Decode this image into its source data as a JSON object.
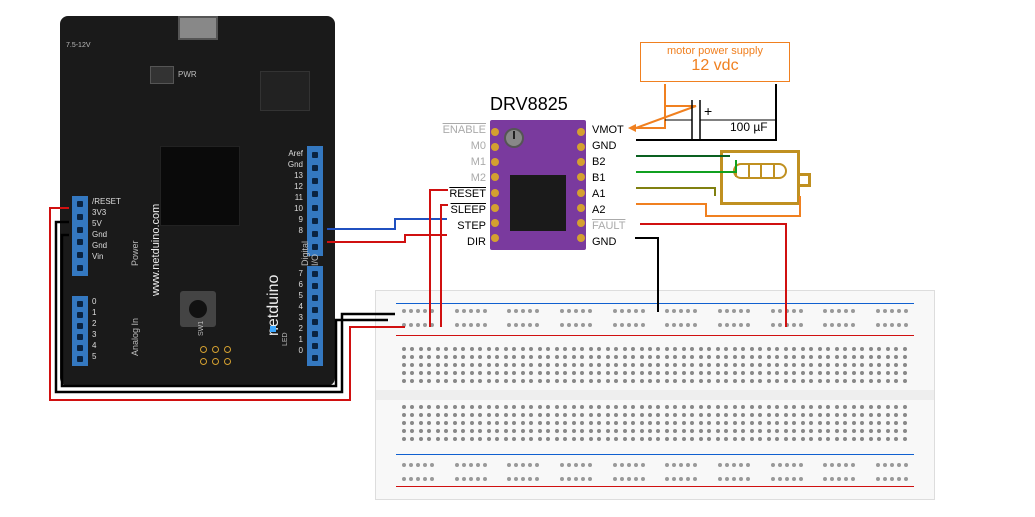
{
  "netduino": {
    "brand_url": "www.netduino.com",
    "brand_name": "netduino",
    "dc_label": "7.5-12V",
    "pwr": "PWR",
    "pin_groups": {
      "power_label": "Power",
      "power": [
        "/RESET",
        "3V3",
        "5V",
        "Gnd",
        "Gnd",
        "Vin"
      ],
      "analog_label": "Analog In",
      "analog": [
        "0",
        "1",
        "2",
        "3",
        "4",
        "5"
      ],
      "digital_label": "Digital I/O",
      "digital_top": [
        "Aref",
        "Gnd",
        "13",
        "12",
        "11",
        "10",
        "9",
        "8"
      ],
      "digital_bot": [
        "7",
        "6",
        "5",
        "4",
        "3",
        "2",
        "1",
        "0"
      ]
    },
    "sw_label": "SW1",
    "led_label": "LED"
  },
  "drv8825": {
    "title": "DRV8825",
    "left_pins": [
      "ENABLE",
      "M0",
      "M1",
      "M2",
      "RESET",
      "SLEEP",
      "STEP",
      "DIR"
    ],
    "right_pins": [
      "VMOT",
      "GND",
      "B2",
      "B1",
      "A1",
      "A2",
      "FAULT",
      "GND"
    ]
  },
  "psu": {
    "label": "motor power supply",
    "voltage": "12 vdc"
  },
  "capacitor": {
    "value": "100 µF",
    "plus": "+"
  },
  "wiring": {
    "connections": [
      {
        "from": "netduino.5V",
        "to": "breadboard.power_rail_pos",
        "color": "red"
      },
      {
        "from": "netduino.Gnd",
        "to": "breadboard.power_rail_neg",
        "color": "black"
      },
      {
        "from": "netduino.Gnd(pin)",
        "to": "breadboard.power_rail_neg",
        "color": "black"
      },
      {
        "from": "netduino.D9",
        "to": "DRV8825.STEP",
        "color": "blue"
      },
      {
        "from": "netduino.D8",
        "to": "DRV8825.DIR",
        "color": "red"
      },
      {
        "from": "breadboard.pos",
        "to": "DRV8825.RESET",
        "color": "red"
      },
      {
        "from": "breadboard.pos",
        "to": "DRV8825.SLEEP",
        "color": "red"
      },
      {
        "from": "breadboard.pos",
        "to": "DRV8825.FAULT",
        "color": "red"
      },
      {
        "from": "breadboard.neg",
        "to": "DRV8825.GND(logic)",
        "color": "black"
      },
      {
        "from": "psu.+12V",
        "to": "DRV8825.VMOT",
        "color": "orange"
      },
      {
        "from": "psu.GND",
        "to": "DRV8825.GND(motor)",
        "color": "black"
      },
      {
        "from": "capacitor",
        "to": "VMOT/GND",
        "color": "black"
      },
      {
        "from": "DRV8825.B2",
        "to": "motor.coilB",
        "color": "darkgreen"
      },
      {
        "from": "DRV8825.B1",
        "to": "motor.coilB",
        "color": "green"
      },
      {
        "from": "DRV8825.A1",
        "to": "motor.coilA",
        "color": "olive"
      },
      {
        "from": "DRV8825.A2",
        "to": "motor.coilA",
        "color": "orange"
      }
    ]
  }
}
